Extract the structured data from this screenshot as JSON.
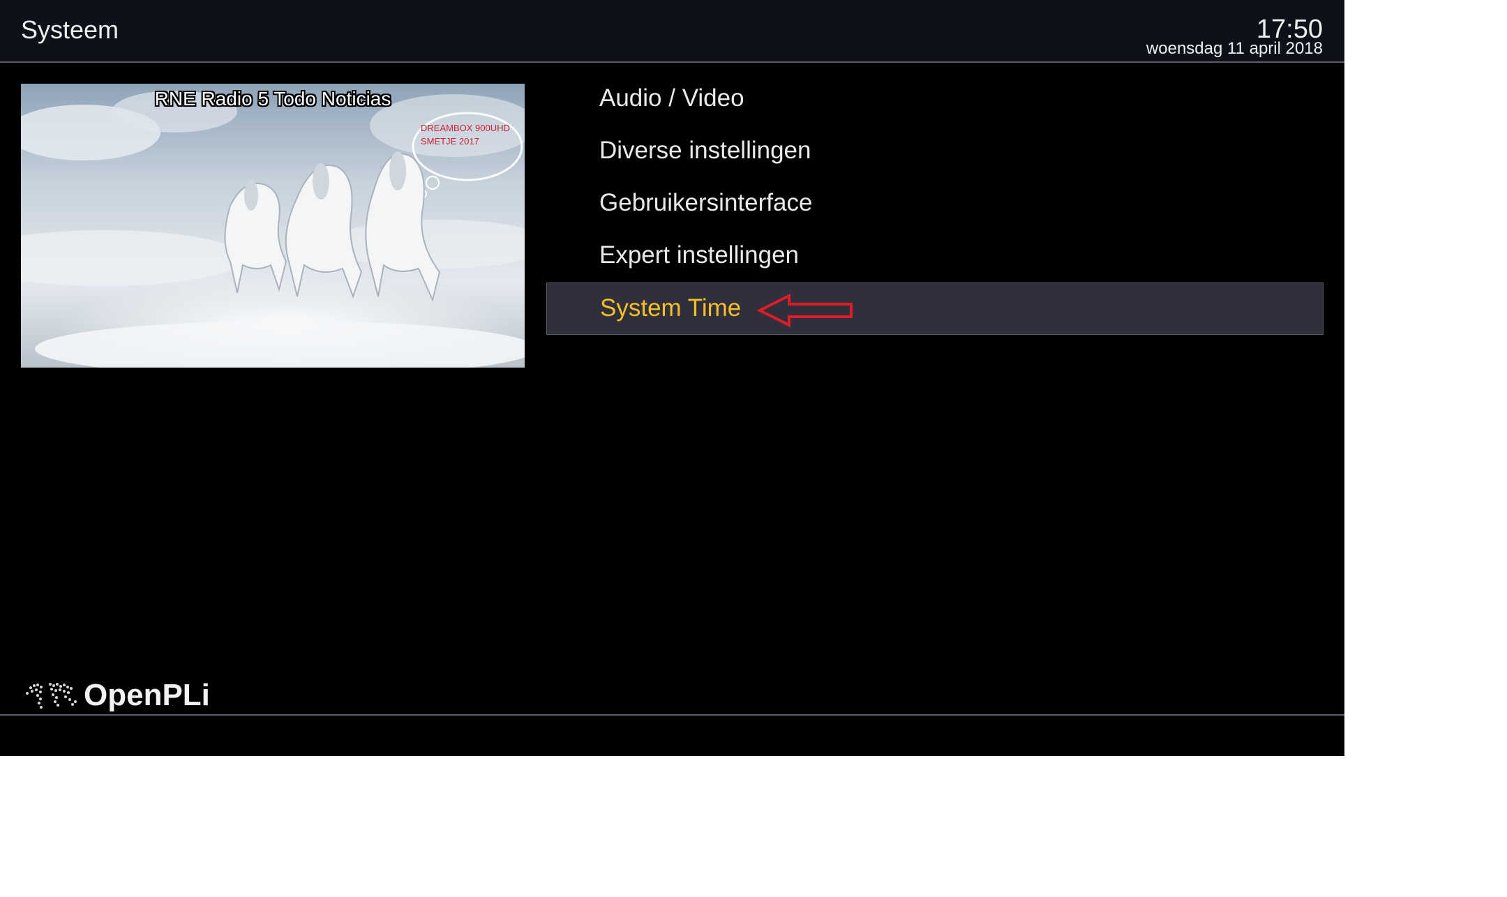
{
  "header": {
    "title": "Systeem",
    "time": "17:50",
    "date": "woensdag 11 april 2018"
  },
  "preview": {
    "channel_name": "RNE Radio 5 Todo Noticias",
    "bubble_line1": "DREAMBOX 900UHD",
    "bubble_line2": "SMETJE 2017"
  },
  "menu": {
    "items": [
      {
        "label": "Audio / Video"
      },
      {
        "label": "Diverse instellingen"
      },
      {
        "label": "Gebruikersinterface"
      },
      {
        "label": "Expert instellingen"
      },
      {
        "label": "System Time"
      }
    ],
    "selected_index": 4,
    "selected_color": "#f5be2a",
    "annotation": "red-arrow-left-icon"
  },
  "brand": {
    "name": "OpenPLi",
    "logo_icon": "world-map-icon"
  }
}
